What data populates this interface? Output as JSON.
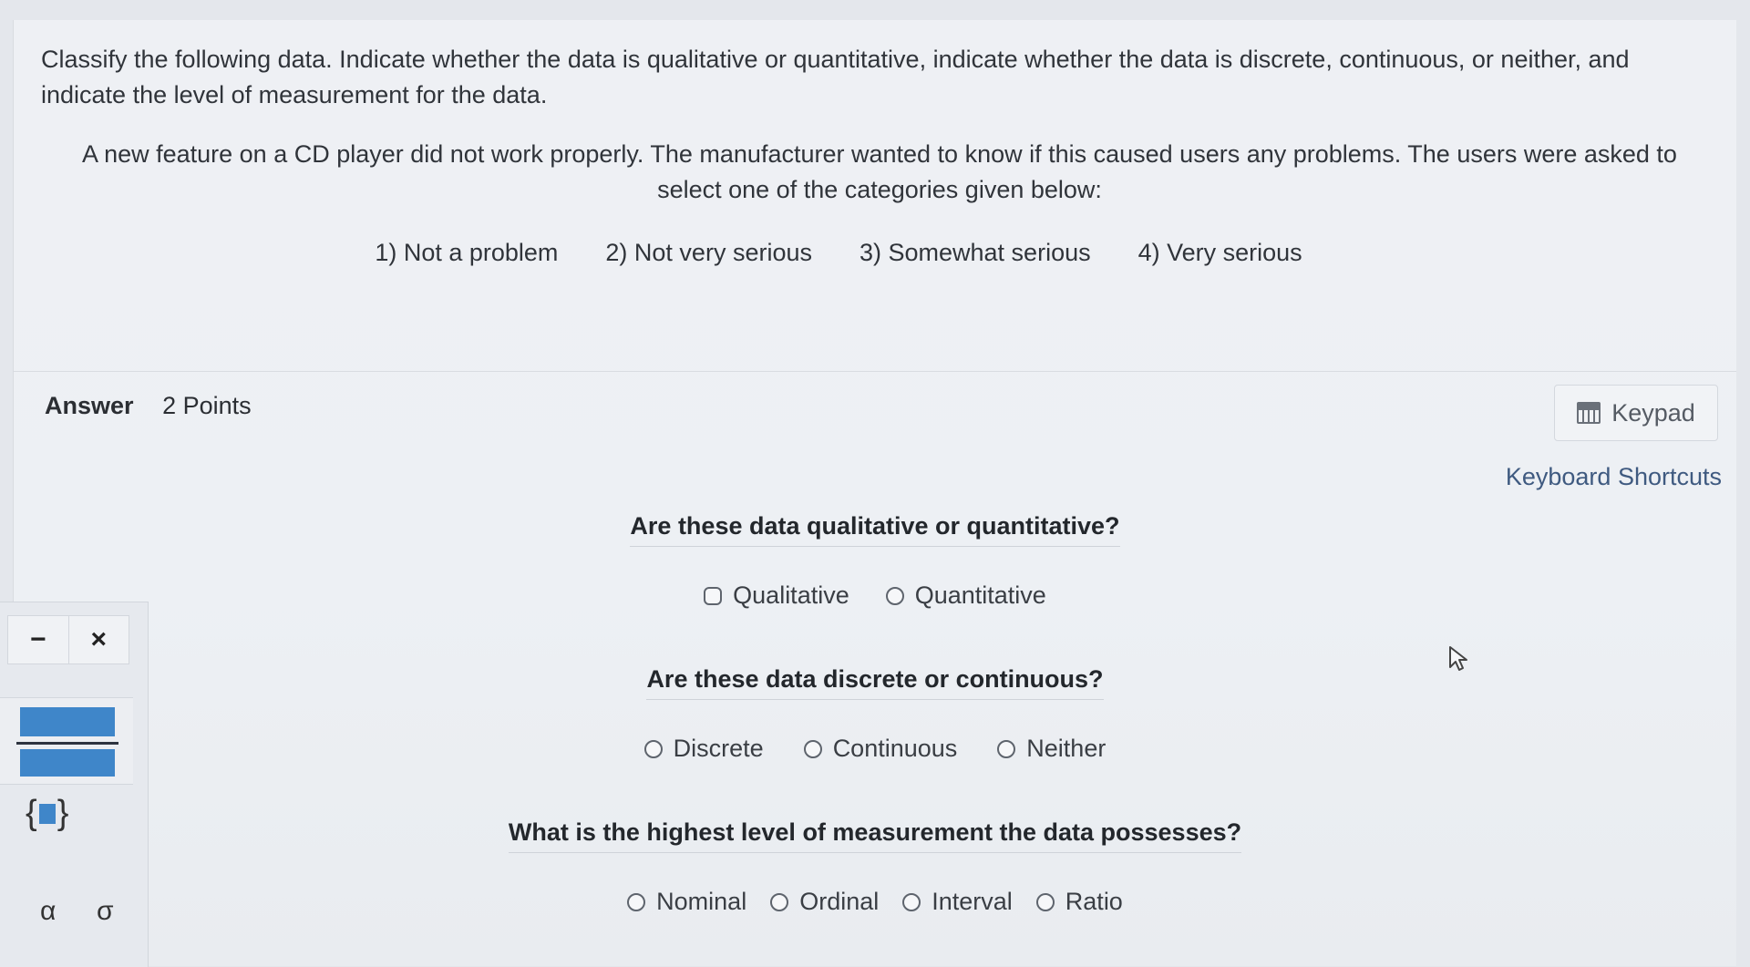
{
  "question": {
    "intro": "Classify the following data. Indicate whether the data is qualitative or quantitative, indicate whether the data is discrete, continuous, or neither, and indicate the level of measurement for the data.",
    "scenario_line1": "A new feature on a CD player did not work properly. The manufacturer wanted to know if this caused users any problems. The users were asked to",
    "scenario_line2": "select one of the categories given below:",
    "categories": [
      "1) Not a problem",
      "2) Not very serious",
      "3) Somewhat serious",
      "4) Very serious"
    ]
  },
  "answer": {
    "label": "Answer",
    "points": "2 Points"
  },
  "keypad": {
    "label": "Keypad"
  },
  "shortcuts": {
    "label": "Keyboard Shortcuts"
  },
  "parts": [
    {
      "prompt": "Are these data qualitative or quantitative?",
      "options": [
        "Qualitative",
        "Quantitative"
      ]
    },
    {
      "prompt": "Are these data discrete or continuous?",
      "options": [
        "Discrete",
        "Continuous",
        "Neither"
      ]
    },
    {
      "prompt": "What is the highest level of measurement the data possesses?",
      "options": [
        "Nominal",
        "Ordinal",
        "Interval",
        "Ratio"
      ]
    }
  ],
  "math_panel": {
    "minimize_symbol": "−",
    "close_symbol": "×",
    "brace_open": "{",
    "brace_close": "}",
    "alpha": "α",
    "sigma": "σ"
  }
}
